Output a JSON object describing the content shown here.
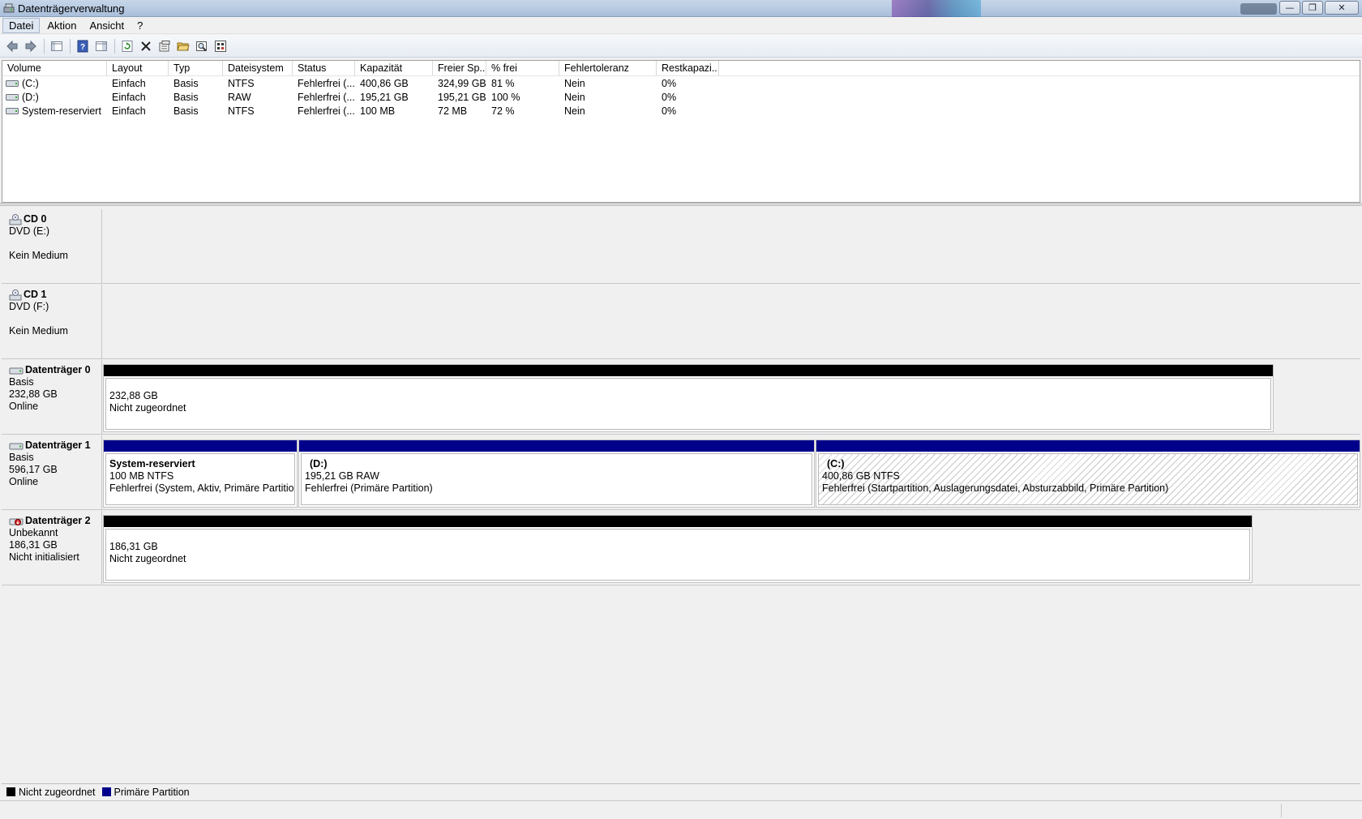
{
  "window": {
    "title": "Datenträgerverwaltung",
    "buttons": {
      "minimize": "—",
      "maximize": "❐",
      "close": "✕"
    }
  },
  "menu": [
    "Datei",
    "Aktion",
    "Ansicht",
    "?"
  ],
  "toolbar": {
    "icons": [
      "back-icon",
      "forward-icon",
      "show-hide-console-tree-icon",
      "help-icon",
      "properties-view-icon",
      "refresh-icon",
      "delete-icon",
      "properties-icon",
      "open-icon",
      "explore-icon",
      "settings-icon"
    ]
  },
  "volumes": {
    "columns": [
      "Volume",
      "Layout",
      "Typ",
      "Dateisystem",
      "Status",
      "Kapazität",
      "Freier Sp...",
      "% frei",
      "Fehlertoleranz",
      "Restkapazi..."
    ],
    "rows": [
      {
        "volume": "(C:)",
        "layout": "Einfach",
        "typ": "Basis",
        "fs": "NTFS",
        "status": "Fehlerfrei (...",
        "capacity": "400,86 GB",
        "free": "324,99 GB",
        "pct": "81 %",
        "fault": "Nein",
        "overhead": "0%"
      },
      {
        "volume": "(D:)",
        "layout": "Einfach",
        "typ": "Basis",
        "fs": "RAW",
        "status": "Fehlerfrei (...",
        "capacity": "195,21 GB",
        "free": "195,21 GB",
        "pct": "100 %",
        "fault": "Nein",
        "overhead": "0%"
      },
      {
        "volume": "System-reserviert",
        "layout": "Einfach",
        "typ": "Basis",
        "fs": "NTFS",
        "status": "Fehlerfrei (...",
        "capacity": "100 MB",
        "free": "72 MB",
        "pct": "72 %",
        "fault": "Nein",
        "overhead": "0%"
      }
    ]
  },
  "disks": {
    "cd0": {
      "name": "CD 0",
      "line1": "DVD (E:)",
      "line3": "Kein Medium"
    },
    "cd1": {
      "name": "CD 1",
      "line1": "DVD (F:)",
      "line3": "Kein Medium"
    },
    "disk0": {
      "name": "Datenträger 0",
      "type": "Basis",
      "size": "232,88 GB",
      "status": "Online",
      "partition": {
        "size": "232,88 GB",
        "label": "Nicht zugeordnet"
      }
    },
    "disk1": {
      "name": "Datenträger 1",
      "type": "Basis",
      "size": "596,17 GB",
      "status": "Online",
      "partitions": [
        {
          "name": "System-reserviert",
          "info": "100 MB NTFS",
          "status": "Fehlerfrei (System, Aktiv, Primäre Partition)"
        },
        {
          "name": "(D:)",
          "info": "195,21 GB RAW",
          "status": "Fehlerfrei (Primäre Partition)"
        },
        {
          "name": "(C:)",
          "info": "400,86 GB NTFS",
          "status": "Fehlerfrei (Startpartition, Auslagerungsdatei, Absturzabbild, Primäre Partition)"
        }
      ]
    },
    "disk2": {
      "name": "Datenträger 2",
      "type": "Unbekannt",
      "size": "186,31 GB",
      "status": "Nicht initialisiert",
      "partition": {
        "size": "186,31 GB",
        "label": "Nicht zugeordnet"
      }
    }
  },
  "legend": [
    {
      "label": "Nicht zugeordnet",
      "color": "#000000"
    },
    {
      "label": "Primäre Partition",
      "color": "#00008b"
    }
  ]
}
